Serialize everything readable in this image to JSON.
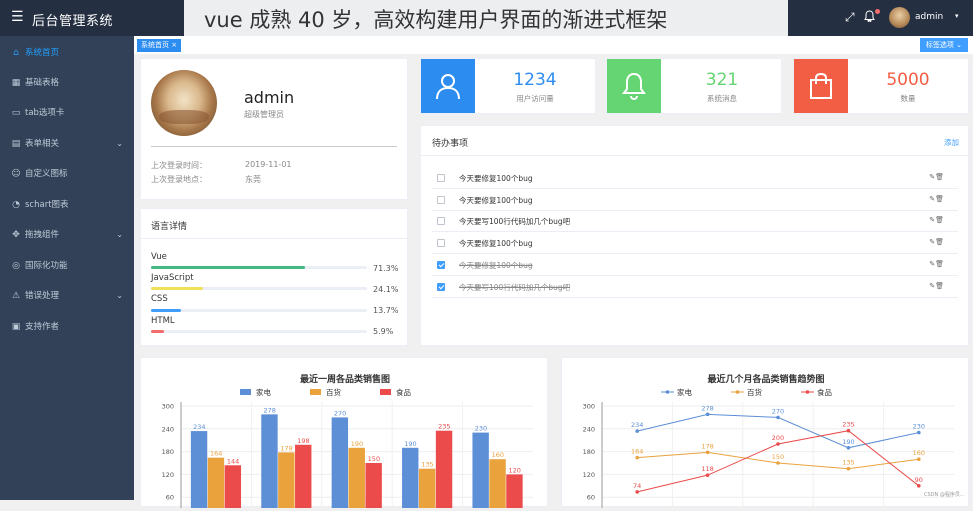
{
  "header": {
    "menu_icon": "menu-icon",
    "title": "后台管理系统",
    "banner": "vue 成熟 40 岁，高效构建用户界面的渐进式框架",
    "fullscreen_icon": "⤢",
    "bell_icon": "🔔",
    "user_name": "admin",
    "caret": "▾"
  },
  "sidebar": {
    "items": [
      {
        "label": "系统首页",
        "icon": "⌂",
        "arrow": "",
        "active": true
      },
      {
        "label": "基础表格",
        "icon": "▦",
        "arrow": ""
      },
      {
        "label": "tab选项卡",
        "icon": "▭",
        "arrow": ""
      },
      {
        "label": "表单相关",
        "icon": "▤",
        "arrow": "⌄"
      },
      {
        "label": "自定义图标",
        "icon": "☺",
        "arrow": ""
      },
      {
        "label": "schart图表",
        "icon": "◔",
        "arrow": ""
      },
      {
        "label": "拖拽组件",
        "icon": "✥",
        "arrow": "⌄"
      },
      {
        "label": "国际化功能",
        "icon": "◎",
        "arrow": ""
      },
      {
        "label": "错误处理",
        "icon": "⚠",
        "arrow": "⌄"
      },
      {
        "label": "支持作者",
        "icon": "▣",
        "arrow": ""
      }
    ]
  },
  "tags": {
    "active_tag": "系统首页 ×",
    "options": "标签选项 ⌄"
  },
  "profile": {
    "name": "admin",
    "role": "超级管理员",
    "last_login_time_label": "上次登录时间：",
    "last_login_time": "2019-11-01",
    "last_login_place_label": "上次登录地点：",
    "last_login_place": "东莞"
  },
  "languages": {
    "title": "语言详情",
    "items": [
      {
        "name": "Vue",
        "percent": "71.3%",
        "value": 71.3,
        "color": "#42b983"
      },
      {
        "name": "JavaScript",
        "percent": "24.1%",
        "value": 24.1,
        "color": "#f1e05a"
      },
      {
        "name": "CSS",
        "percent": "13.7%",
        "value": 13.7,
        "color": "#409eff"
      },
      {
        "name": "HTML",
        "percent": "5.9%",
        "value": 5.9,
        "color": "#f56c6c"
      }
    ]
  },
  "stats": [
    {
      "value": "1234",
      "label": "用户访问量",
      "icon": "user-icon",
      "color": "#2d8cf0"
    },
    {
      "value": "321",
      "label": "系统消息",
      "icon": "bell-icon",
      "color": "#64d572"
    },
    {
      "value": "5000",
      "label": "数量",
      "icon": "bag-icon",
      "color": "#f25e43"
    }
  ],
  "todo": {
    "title": "待办事项",
    "add": "添加",
    "actions": "✎🗑",
    "items": [
      {
        "text": "今天要修复100个bug",
        "done": false
      },
      {
        "text": "今天要修复100个bug",
        "done": false
      },
      {
        "text": "今天要写100行代码加几个bug吧",
        "done": false
      },
      {
        "text": "今天要修复100个bug",
        "done": false
      },
      {
        "text": "今天要修复100个bug",
        "done": true
      },
      {
        "text": "今天要写100行代码加几个bug吧",
        "done": true
      }
    ]
  },
  "chart_data": [
    {
      "type": "bar",
      "title": "最近一周各品类销售图",
      "categories": [
        "",
        "",
        "",
        "",
        ""
      ],
      "ylim": [
        0,
        300
      ],
      "yticks": [
        60,
        120,
        180,
        240,
        300
      ],
      "series": [
        {
          "name": "家电",
          "color": "#5c8fd6",
          "values": [
            234,
            278,
            270,
            190,
            230
          ]
        },
        {
          "name": "百货",
          "color": "#eaa23d",
          "values": [
            164,
            178,
            190,
            135,
            160
          ]
        },
        {
          "name": "食品",
          "color": "#eb4b4b",
          "values": [
            144,
            198,
            150,
            235,
            120
          ]
        }
      ],
      "legend": "top"
    },
    {
      "type": "line",
      "title": "最近几个月各品类销售趋势图",
      "categories": [
        "",
        "",
        "",
        "",
        ""
      ],
      "ylim": [
        0,
        300
      ],
      "yticks": [
        60,
        120,
        180,
        240,
        300
      ],
      "series": [
        {
          "name": "家电",
          "color": "#5c8fd6",
          "values": [
            234,
            278,
            270,
            190,
            230
          ]
        },
        {
          "name": "百货",
          "color": "#eaa23d",
          "values": [
            164,
            178,
            150,
            135,
            160
          ]
        },
        {
          "name": "食品",
          "color": "#eb4b4b",
          "values": [
            74,
            118,
            200,
            235,
            90
          ]
        }
      ],
      "legend": "top"
    }
  ],
  "watermark": "CSDN @程序员..."
}
